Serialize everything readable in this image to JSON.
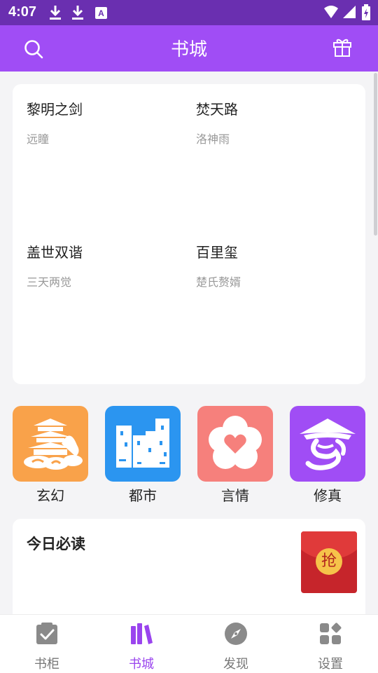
{
  "status_bar": {
    "time": "4:07"
  },
  "app_bar": {
    "title": "书城"
  },
  "books": [
    {
      "title": "黎明之剑",
      "author": "远瞳"
    },
    {
      "title": "焚天路",
      "author": "洛神雨"
    },
    {
      "title": "盖世双谐",
      "author": "三天两觉"
    },
    {
      "title": "百里玺",
      "author": "楚氏赘婿"
    }
  ],
  "categories": [
    {
      "label": "玄幻",
      "color": "#f9a24a",
      "icon": "pagoda-icon"
    },
    {
      "label": "都市",
      "color": "#2b95f0",
      "icon": "city-icon"
    },
    {
      "label": "言情",
      "color": "#f6807c",
      "icon": "flower-heart-icon"
    },
    {
      "label": "修真",
      "color": "#a04df5",
      "icon": "straw-hat-icon"
    }
  ],
  "today": {
    "title": "今日必读",
    "red_packet": "抢"
  },
  "nav": [
    {
      "label": "书柜",
      "icon": "bookshelf-icon",
      "active": false
    },
    {
      "label": "书城",
      "icon": "books-icon",
      "active": true
    },
    {
      "label": "发现",
      "icon": "compass-icon",
      "active": false
    },
    {
      "label": "设置",
      "icon": "settings-grid-icon",
      "active": false
    }
  ],
  "colors": {
    "accent": "#a04df5",
    "status_bar": "#6a2fb0",
    "background": "#f4f4f6"
  }
}
